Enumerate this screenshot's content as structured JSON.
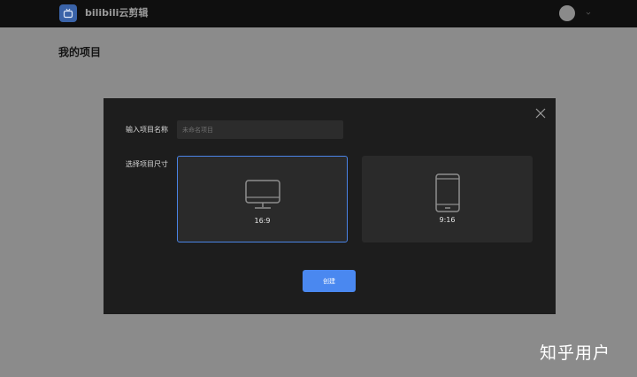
{
  "app": {
    "title": "bilibili云剪辑",
    "logo_icon": "tv-icon",
    "brand_color": "#3a63a8"
  },
  "header": {
    "avatar_icon": "user-avatar",
    "caret_icon": "chevron-down-icon"
  },
  "page": {
    "title": "我的项目"
  },
  "modal": {
    "close_icon": "close-icon",
    "name_label": "输入项目名称",
    "name_placeholder": "未命名项目",
    "name_value": "",
    "size_label": "选择项目尺寸",
    "sizes": [
      {
        "label": "16:9",
        "icon": "monitor-icon",
        "selected": true
      },
      {
        "label": "9:16",
        "icon": "phone-icon",
        "selected": false
      }
    ],
    "create_label": "创建",
    "accent_color": "#4a88f0"
  },
  "watermark": {
    "text": "知乎用户"
  }
}
